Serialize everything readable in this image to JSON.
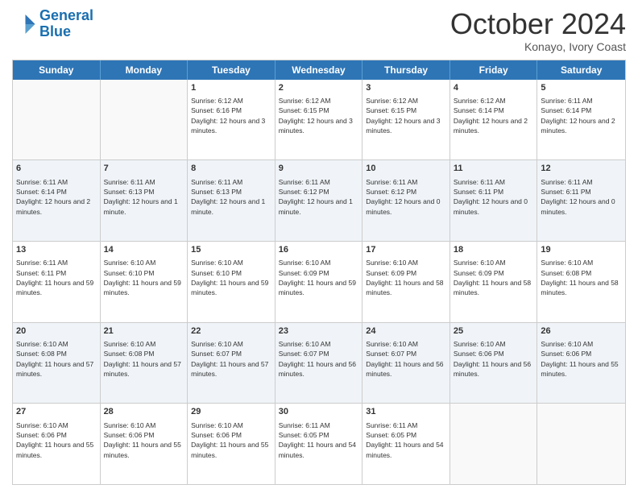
{
  "logo": {
    "line1": "General",
    "line2": "Blue"
  },
  "title": "October 2024",
  "subtitle": "Konayo, Ivory Coast",
  "days": [
    "Sunday",
    "Monday",
    "Tuesday",
    "Wednesday",
    "Thursday",
    "Friday",
    "Saturday"
  ],
  "weeks": [
    [
      {
        "day": "",
        "info": ""
      },
      {
        "day": "",
        "info": ""
      },
      {
        "day": "1",
        "info": "Sunrise: 6:12 AM\nSunset: 6:16 PM\nDaylight: 12 hours and 3 minutes."
      },
      {
        "day": "2",
        "info": "Sunrise: 6:12 AM\nSunset: 6:15 PM\nDaylight: 12 hours and 3 minutes."
      },
      {
        "day": "3",
        "info": "Sunrise: 6:12 AM\nSunset: 6:15 PM\nDaylight: 12 hours and 3 minutes."
      },
      {
        "day": "4",
        "info": "Sunrise: 6:12 AM\nSunset: 6:14 PM\nDaylight: 12 hours and 2 minutes."
      },
      {
        "day": "5",
        "info": "Sunrise: 6:11 AM\nSunset: 6:14 PM\nDaylight: 12 hours and 2 minutes."
      }
    ],
    [
      {
        "day": "6",
        "info": "Sunrise: 6:11 AM\nSunset: 6:14 PM\nDaylight: 12 hours and 2 minutes."
      },
      {
        "day": "7",
        "info": "Sunrise: 6:11 AM\nSunset: 6:13 PM\nDaylight: 12 hours and 1 minute."
      },
      {
        "day": "8",
        "info": "Sunrise: 6:11 AM\nSunset: 6:13 PM\nDaylight: 12 hours and 1 minute."
      },
      {
        "day": "9",
        "info": "Sunrise: 6:11 AM\nSunset: 6:12 PM\nDaylight: 12 hours and 1 minute."
      },
      {
        "day": "10",
        "info": "Sunrise: 6:11 AM\nSunset: 6:12 PM\nDaylight: 12 hours and 0 minutes."
      },
      {
        "day": "11",
        "info": "Sunrise: 6:11 AM\nSunset: 6:11 PM\nDaylight: 12 hours and 0 minutes."
      },
      {
        "day": "12",
        "info": "Sunrise: 6:11 AM\nSunset: 6:11 PM\nDaylight: 12 hours and 0 minutes."
      }
    ],
    [
      {
        "day": "13",
        "info": "Sunrise: 6:11 AM\nSunset: 6:11 PM\nDaylight: 11 hours and 59 minutes."
      },
      {
        "day": "14",
        "info": "Sunrise: 6:10 AM\nSunset: 6:10 PM\nDaylight: 11 hours and 59 minutes."
      },
      {
        "day": "15",
        "info": "Sunrise: 6:10 AM\nSunset: 6:10 PM\nDaylight: 11 hours and 59 minutes."
      },
      {
        "day": "16",
        "info": "Sunrise: 6:10 AM\nSunset: 6:09 PM\nDaylight: 11 hours and 59 minutes."
      },
      {
        "day": "17",
        "info": "Sunrise: 6:10 AM\nSunset: 6:09 PM\nDaylight: 11 hours and 58 minutes."
      },
      {
        "day": "18",
        "info": "Sunrise: 6:10 AM\nSunset: 6:09 PM\nDaylight: 11 hours and 58 minutes."
      },
      {
        "day": "19",
        "info": "Sunrise: 6:10 AM\nSunset: 6:08 PM\nDaylight: 11 hours and 58 minutes."
      }
    ],
    [
      {
        "day": "20",
        "info": "Sunrise: 6:10 AM\nSunset: 6:08 PM\nDaylight: 11 hours and 57 minutes."
      },
      {
        "day": "21",
        "info": "Sunrise: 6:10 AM\nSunset: 6:08 PM\nDaylight: 11 hours and 57 minutes."
      },
      {
        "day": "22",
        "info": "Sunrise: 6:10 AM\nSunset: 6:07 PM\nDaylight: 11 hours and 57 minutes."
      },
      {
        "day": "23",
        "info": "Sunrise: 6:10 AM\nSunset: 6:07 PM\nDaylight: 11 hours and 56 minutes."
      },
      {
        "day": "24",
        "info": "Sunrise: 6:10 AM\nSunset: 6:07 PM\nDaylight: 11 hours and 56 minutes."
      },
      {
        "day": "25",
        "info": "Sunrise: 6:10 AM\nSunset: 6:06 PM\nDaylight: 11 hours and 56 minutes."
      },
      {
        "day": "26",
        "info": "Sunrise: 6:10 AM\nSunset: 6:06 PM\nDaylight: 11 hours and 55 minutes."
      }
    ],
    [
      {
        "day": "27",
        "info": "Sunrise: 6:10 AM\nSunset: 6:06 PM\nDaylight: 11 hours and 55 minutes."
      },
      {
        "day": "28",
        "info": "Sunrise: 6:10 AM\nSunset: 6:06 PM\nDaylight: 11 hours and 55 minutes."
      },
      {
        "day": "29",
        "info": "Sunrise: 6:10 AM\nSunset: 6:06 PM\nDaylight: 11 hours and 55 minutes."
      },
      {
        "day": "30",
        "info": "Sunrise: 6:11 AM\nSunset: 6:05 PM\nDaylight: 11 hours and 54 minutes."
      },
      {
        "day": "31",
        "info": "Sunrise: 6:11 AM\nSunset: 6:05 PM\nDaylight: 11 hours and 54 minutes."
      },
      {
        "day": "",
        "info": ""
      },
      {
        "day": "",
        "info": ""
      }
    ]
  ]
}
